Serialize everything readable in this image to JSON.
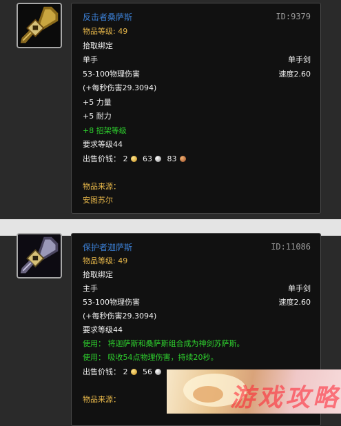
{
  "items": [
    {
      "name": "反击者桑萨斯",
      "id": "ID:9379",
      "item_level": "物品等级: 49",
      "bind": "拾取绑定",
      "slot": "单手",
      "weapon_type": "单手剑",
      "damage": "53-100物理伤害",
      "speed": "速度2.60",
      "dps": "(+每秒伤害29.3094)",
      "stats": [
        "+5 力量",
        "+5 耐力"
      ],
      "bonus": "+8 招架等级",
      "required_level": "要求等级44",
      "sell_label": "出售价钱：",
      "sell_gold": "2",
      "sell_silver": "63",
      "sell_copper": "83",
      "source_label": "物品来源：",
      "source_value": "安图苏尔"
    },
    {
      "name": "保护者迦萨斯",
      "id": "ID:11086",
      "item_level": "物品等级: 49",
      "bind": "拾取绑定",
      "slot": "主手",
      "weapon_type": "单手剑",
      "damage": "53-100物理伤害",
      "speed": "速度2.60",
      "dps": "(+每秒伤害29.3094)",
      "required_level": "要求等级44",
      "uses": [
        "使用： 将迦萨斯和桑萨斯组合成为神剑苏萨斯。",
        "使用： 吸收54点物理伤害，持续20秒。"
      ],
      "sell_label": "出售价钱：",
      "sell_gold": "2",
      "sell_silver": "56",
      "source_label": "物品来源："
    }
  ],
  "watermark": "游戏攻略",
  "colors": {
    "name": "#3b7fd4",
    "item_level": "#e8b84a",
    "green": "#2ed12e",
    "id": "#9a9a9a"
  }
}
